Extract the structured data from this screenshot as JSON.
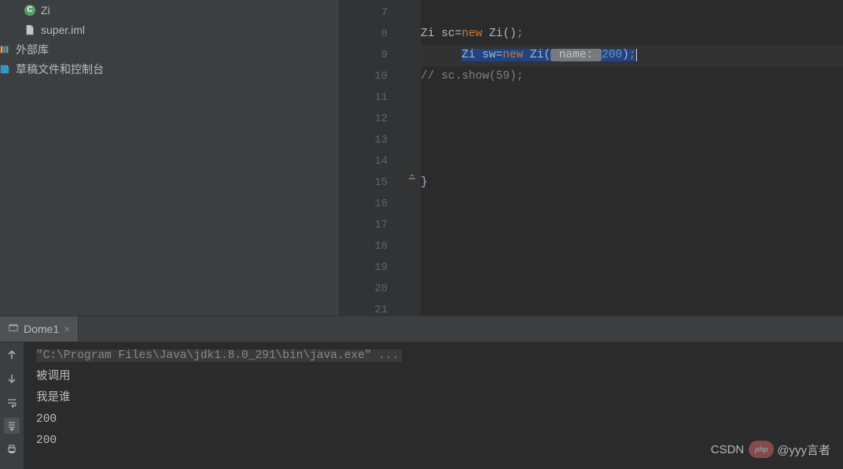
{
  "sidebar": {
    "items": [
      {
        "label": "Zi",
        "icon": "class"
      },
      {
        "label": "super.iml",
        "icon": "file"
      },
      {
        "label": "外部库",
        "icon": "lib"
      },
      {
        "label": "草稿文件和控制台",
        "icon": "scratch"
      }
    ]
  },
  "editor": {
    "lines": [
      7,
      8,
      9,
      10,
      11,
      12,
      13,
      14,
      15,
      16,
      17,
      18,
      19,
      20,
      21
    ],
    "code": {
      "l7": "",
      "l8": {
        "pre": "Zi ",
        "var": "sc",
        "eq": "=",
        "kw": "new",
        "post": " Zi()",
        "semi": ";"
      },
      "l9": {
        "pre": "Zi ",
        "var": "sw",
        "eq": "=",
        "kw": "new",
        "post": " Zi(",
        "hint": " name: ",
        "num": "200",
        "close": ")",
        "semi": ";"
      },
      "l10": "// sc.show(59);",
      "l15": "}"
    }
  },
  "tabs": [
    {
      "label": "Dome1"
    }
  ],
  "console": {
    "cmd": "\"C:\\Program Files\\Java\\jdk1.8.0_291\\bin\\java.exe\" ...",
    "lines": [
      "被调用",
      "我是谁",
      "200",
      "200"
    ]
  },
  "watermark": {
    "site": "CSDN",
    "author": "@yyy言者"
  }
}
